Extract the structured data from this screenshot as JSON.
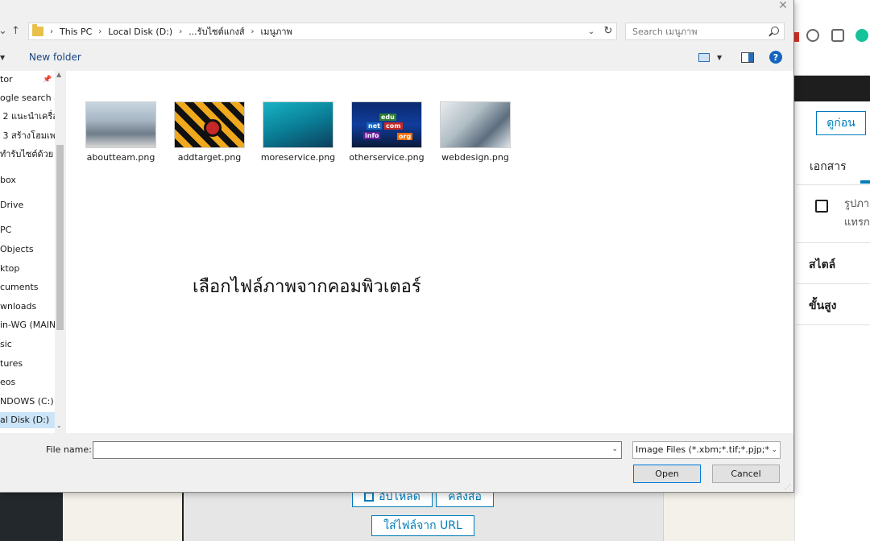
{
  "dialog": {
    "breadcrumb": [
      "This PC",
      "Local Disk (D:)",
      "...รับไซต์แกงส์",
      "เมนูภาพ"
    ],
    "search": {
      "placeholder": "Search เมนูภาพ"
    },
    "toolbar": {
      "new_folder": "New folder"
    },
    "nav_items": [
      {
        "label": "tor",
        "pinned": true
      },
      {
        "label": "ogle search a"
      },
      {
        "label": "ี่ 2 แนะนำเครื่อ"
      },
      {
        "label": "ี่ 3 สร้างโฮมเพจ"
      },
      {
        "label": "ทำรับไซต์ด้วย"
      },
      {
        "label": "box"
      },
      {
        "label": "Drive"
      },
      {
        "label": "PC"
      },
      {
        "label": "Objects"
      },
      {
        "label": "ktop"
      },
      {
        "label": "cuments"
      },
      {
        "label": "wnloads"
      },
      {
        "label": "in-WG (MAIN"
      },
      {
        "label": "sic"
      },
      {
        "label": "tures"
      },
      {
        "label": "eos"
      },
      {
        "label": "NDOWS (C:)"
      },
      {
        "label": "al Disk (D:)",
        "selected": true
      }
    ],
    "files": [
      {
        "name": "aboutteam.png"
      },
      {
        "name": "addtarget.png"
      },
      {
        "name": "moreservice.png"
      },
      {
        "name": "otherservice.png",
        "tags": [
          "edu",
          "net",
          "com",
          "info",
          "org"
        ]
      },
      {
        "name": "webdesign.png"
      }
    ],
    "caption": "เลือกไฟล์ภาพจากคอมพิวเตอร์",
    "filename_label": "File name:",
    "filename_value": "",
    "filetype": "Image Files (*.xbm;*.tif;*.pjp;*.p",
    "open_label": "Open",
    "cancel_label": "Cancel"
  },
  "editor": {
    "preview_label": "ดูก่อน",
    "document_tab": "เอกสาร",
    "image_text_line1": "รูปภา",
    "image_text_line2": "แทรก",
    "style_heading": "สไตล์",
    "advanced_heading": "ขั้นสูง",
    "upload_label": "อัปโหลด",
    "library_label": "คลังสื่อ",
    "insert_url_label": "ใส่ไฟล์จาก URL"
  }
}
